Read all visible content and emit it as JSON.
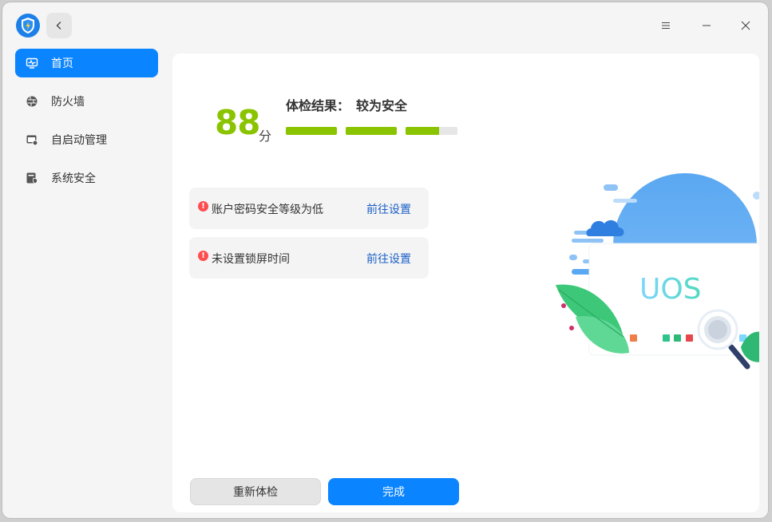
{
  "window": {
    "title_buttons": [
      "menu-icon",
      "minimize-icon",
      "close-icon"
    ]
  },
  "sidebar": {
    "items": [
      {
        "label": "首页",
        "icon": "monitor-icon",
        "active": true
      },
      {
        "label": "防火墙",
        "icon": "firewall-icon",
        "active": false
      },
      {
        "label": "自启动管理",
        "icon": "startup-icon",
        "active": false
      },
      {
        "label": "系统安全",
        "icon": "security-icon",
        "active": false
      }
    ]
  },
  "result": {
    "score": "88",
    "unit": "分",
    "label": "体检结果：",
    "value": "较为安全",
    "segment_fill": [
      1,
      1,
      0.65
    ]
  },
  "issues": [
    {
      "text": "账户密码安全等级为低",
      "action": "前往设置"
    },
    {
      "text": "未设置锁屏时间",
      "action": "前往设置"
    }
  ],
  "illustration": {
    "label": "UOS"
  },
  "buttons": {
    "recheck": "重新体检",
    "done": "完成"
  },
  "colors": {
    "accent": "#0a84ff",
    "score": "#8ac400",
    "warning": "#ff4d4f",
    "link": "#1a5fc7"
  }
}
